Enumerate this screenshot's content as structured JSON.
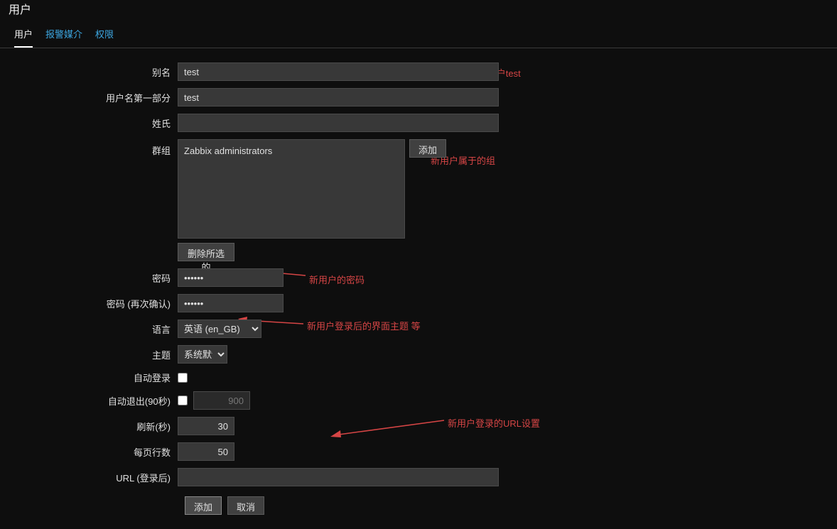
{
  "page": {
    "title": "用户"
  },
  "tabs": [
    {
      "label": "用户",
      "active": true
    },
    {
      "label": "报警媒介",
      "active": false
    },
    {
      "label": "权限",
      "active": false
    }
  ],
  "labels": {
    "alias": "别名",
    "name_first": "用户名第一部分",
    "surname": "姓氏",
    "groups": "群组",
    "password": "密码",
    "password_confirm": "密码 (再次确认)",
    "language": "语言",
    "theme": "主题",
    "auto_login": "自动登录",
    "auto_logout": "自动退出(90秒)",
    "refresh": "刷新(秒)",
    "rows_per_page": "每页行数",
    "url_after_login": "URL (登录后)"
  },
  "values": {
    "alias": "test",
    "name_first": "test",
    "surname": "",
    "groups_items": [
      "Zabbix administrators"
    ],
    "password": "●●●●●●",
    "password_confirm": "●●●●●●",
    "language": "英语 (en_GB)",
    "theme": "系统默认",
    "auto_login": false,
    "auto_logout_enabled": false,
    "auto_logout_value": "900",
    "refresh": "30",
    "rows_per_page": "50",
    "url_after_login": ""
  },
  "buttons": {
    "add_group": "添加",
    "delete_selected": "删除所选的",
    "submit_add": "添加",
    "cancel": "取消"
  },
  "annotations": {
    "a1": "新建 zabbix 用户test",
    "a2": "新用户属于的组",
    "a3": "新用户的密码",
    "a4": "新用户登录后的界面主题 等",
    "a5": "新用户登录的URL设置"
  }
}
